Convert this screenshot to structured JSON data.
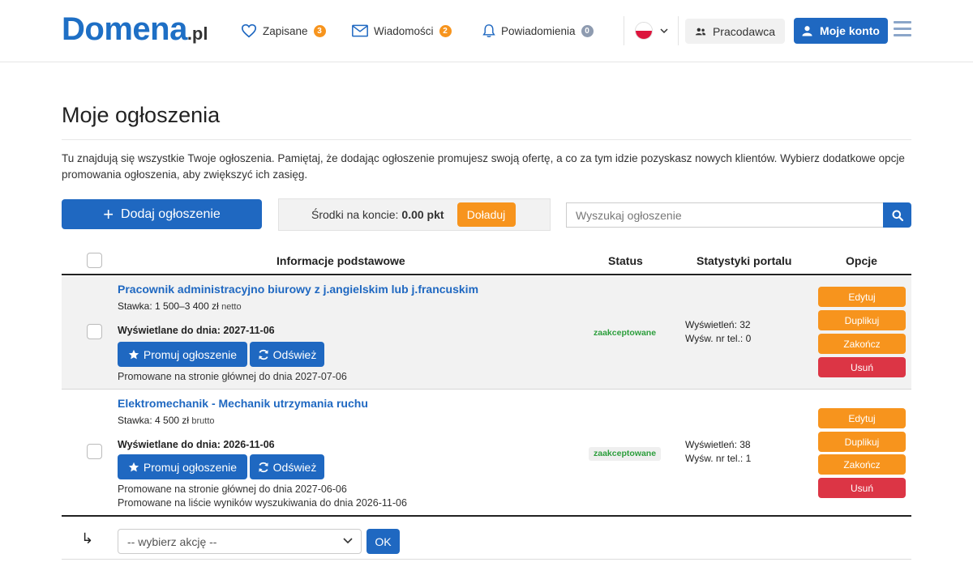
{
  "header": {
    "logo_main": "Domena",
    "logo_tld": ".pl",
    "saved_label": "Zapisane",
    "saved_count": "3",
    "messages_label": "Wiadomości",
    "messages_count": "2",
    "notifications_label": "Powiadomienia",
    "notifications_count": "0",
    "employer_label": "Pracodawca",
    "account_label": "Moje konto"
  },
  "page": {
    "title": "Moje ogłoszenia",
    "intro": "Tu znajdują się wszystkie Twoje ogłoszenia. Pamiętaj, że dodając ogłoszenie promujesz swoją ofertę, a co za tym idzie pozyskasz nowych klientów. Wybierz dodatkowe opcje promowania ogłoszenia, aby zwiększyć ich zasięg."
  },
  "toolbar": {
    "add_label": "Dodaj ogłoszenie",
    "funds_label": "Środki na koncie:",
    "funds_value": "0.00 pkt",
    "topup_label": "Doładuj",
    "search_placeholder": "Wyszukaj ogłoszenie"
  },
  "table": {
    "headers": {
      "info": "Informacje podstawowe",
      "status": "Status",
      "stats": "Statystyki portalu",
      "options": "Opcje"
    },
    "rows": [
      {
        "title": "Pracownik administracyjno biurowy z j.angielskim lub j.francuskim",
        "rate_prefix": "Stawka: 1 500–3 400 zł",
        "rate_type": "netto",
        "shown_until": "Wyświetlane do dnia: 2027-11-06",
        "promo_label": "Promuj ogłoszenie",
        "refresh_label": "Odśwież",
        "notes": [
          "Promowane na stronie głównej do dnia 2027-07-06"
        ],
        "status": "zaakceptowane",
        "views": "Wyświetleń: 32",
        "phone_views": "Wyśw. nr tel.: 0",
        "options": [
          "Edytuj",
          "Duplikuj",
          "Zakończ",
          "Usuń"
        ]
      },
      {
        "title": "Elektromechanik - Mechanik utrzymania ruchu",
        "rate_prefix": "Stawka: 4 500 zł",
        "rate_type": "brutto",
        "shown_until": "Wyświetlane do dnia: 2026-11-06",
        "promo_label": "Promuj ogłoszenie",
        "refresh_label": "Odśwież",
        "notes": [
          "Promowane na stronie głównej do dnia 2027-06-06",
          "Promowane na liście wyników wyszukiwania do dnia 2026-11-06"
        ],
        "status": "zaakceptowane",
        "views": "Wyświetleń: 38",
        "phone_views": "Wyśw. nr tel.: 1",
        "options": [
          "Edytuj",
          "Duplikuj",
          "Zakończ",
          "Usuń"
        ]
      }
    ]
  },
  "bulk": {
    "select_value": "-- wybierz akcję --",
    "ok_label": "OK"
  },
  "colors": {
    "primary": "#1f68c1",
    "accent_orange": "#f7941d",
    "danger": "#dc3545",
    "status_green": "#2c9e3c"
  }
}
